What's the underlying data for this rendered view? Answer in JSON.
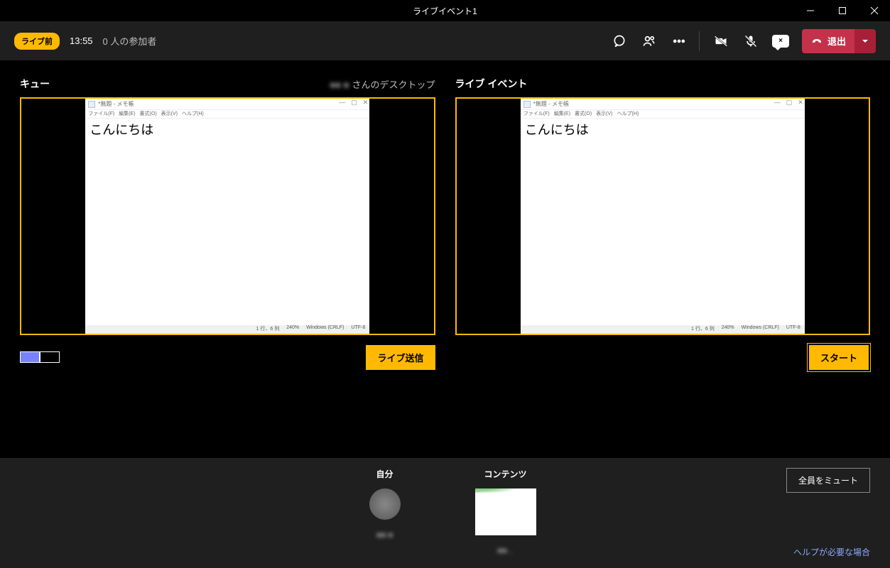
{
  "window": {
    "title": "ライブイベント1"
  },
  "toolbar": {
    "status_pill": "ライブ前",
    "time": "13:55",
    "participants": "0 人の参加者",
    "cc_label": "×",
    "leave_label": "退出"
  },
  "queue_panel": {
    "title": "キュー",
    "source_label_blur": "■■ ■",
    "source_label": "さんのデスクトップ",
    "send_button": "ライブ送信"
  },
  "live_panel": {
    "title": "ライブ イベント",
    "start_button": "スタート"
  },
  "notepad": {
    "title": "*無題 - メモ帳",
    "menu": [
      "ファイル(F)",
      "編集(E)",
      "書式(O)",
      "表示(V)",
      "ヘルプ(H)"
    ],
    "content": "こんにちは",
    "status": {
      "pos": "1 行、6 列",
      "zoom": "240%",
      "enc": "Windows (CRLF)",
      "charset": "UTF-8"
    }
  },
  "tray": {
    "self_label": "自分",
    "content_label": "コンテンツ",
    "self_name": "■■ ■",
    "content_name": "■■...",
    "mute_all": "全員をミュート",
    "help_link": "ヘルプが必要な場合"
  }
}
